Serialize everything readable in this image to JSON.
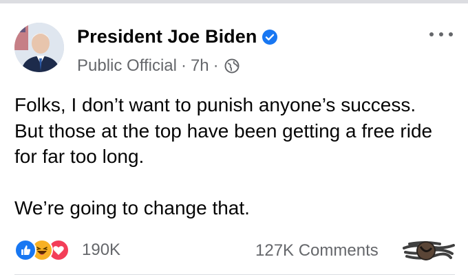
{
  "author": {
    "name": "President Joe Biden",
    "verified": true
  },
  "meta": {
    "category": "Public Official",
    "separator": "·",
    "time": "7h",
    "audience_icon": "globe-icon"
  },
  "post": {
    "paragraphs": [
      "Folks, I don’t want to punish anyone’s success. But those at the top have been getting a free ride for far too long.",
      "We’re going to change that."
    ]
  },
  "reactions": {
    "types": [
      "like",
      "haha",
      "love"
    ],
    "count": "190K"
  },
  "comments": {
    "label": "127K Comments"
  },
  "colors": {
    "text": "#050505",
    "secondary": "#65676b",
    "verified_blue": "#1877f2",
    "love_red": "#f33e58",
    "haha_yellow": "#f7b125"
  }
}
